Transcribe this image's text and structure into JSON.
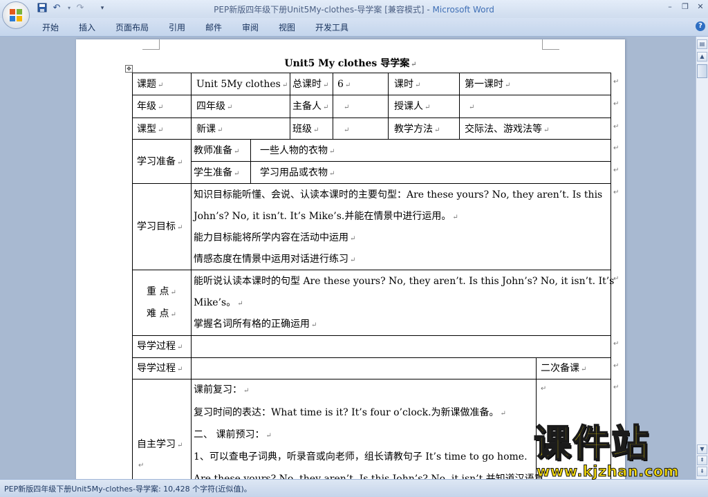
{
  "window": {
    "title_doc": "PEP新版四年级下册Unit5My-clothes-导学案 [兼容模式] - ",
    "title_app": "Microsoft Word"
  },
  "quick_access": {
    "save_icon": "save-icon",
    "undo_icon": "undo-icon",
    "redo_icon": "redo-icon"
  },
  "ribbon": {
    "tabs": [
      "开始",
      "插入",
      "页面布局",
      "引用",
      "邮件",
      "审阅",
      "视图",
      "开发工具"
    ]
  },
  "document": {
    "title": "Unit5 My clothes  导学案",
    "lesson_table": [
      [
        "课题",
        "Unit 5My clothes",
        "总课时",
        "6",
        "课时",
        "第一课时"
      ],
      [
        "年级",
        "四年级",
        "主备人",
        "",
        "授课人",
        ""
      ],
      [
        "课型",
        "新课",
        "班级",
        "",
        "教学方法",
        "交际法、游戏法等"
      ]
    ],
    "prep": {
      "label": "学习准备",
      "rows": [
        {
          "k": "教师准备",
          "v": "一些人物的衣物"
        },
        {
          "k": "学生准备",
          "v": "学习用品或衣物"
        }
      ]
    },
    "goals": {
      "label": "学习目标",
      "lines": [
        "知识目标能听懂、会说、认读本课时的主要句型：Are these yours? No, they aren’t. Is this",
        "John’s? No, it isn’t. It’s Mike’s.并能在情景中进行运用。",
        "能力目标能将所学内容在活动中运用",
        "情感态度在情景中运用对话进行练习"
      ]
    },
    "key_points": {
      "label_1": "重  点",
      "label_2": "难  点",
      "lines": [
        "能听说认读本课时的句型 Are these yours? No, they aren’t. Is this John’s? No, it isn’t. It’s",
        "Mike’s。",
        "掌握名词所有格的正确运用"
      ]
    },
    "process_heading": "导学过程",
    "process_header": {
      "left": "导学过程",
      "right": "二次备课"
    },
    "self_study": {
      "label": "自主学习",
      "lines": [
        "课前复习：",
        "复习时间的表达：What time is it? It’s four o’clock.为新课做准备。",
        "二、 课前预习：",
        "1、可以查电子词典，听录音或向老师，组长请教句子 It’s time to go home.",
        "Are these yours? No, they aren’t. Is this John’s? No, it isn’t.并知道汉语意"
      ]
    }
  },
  "status": {
    "text": "PEP新版四年级下册Unit5My-clothes-导学案: 10,428 个字符(近似值)。"
  },
  "watermark": {
    "text": "课件站",
    "url": "www.kjzhan.com"
  }
}
